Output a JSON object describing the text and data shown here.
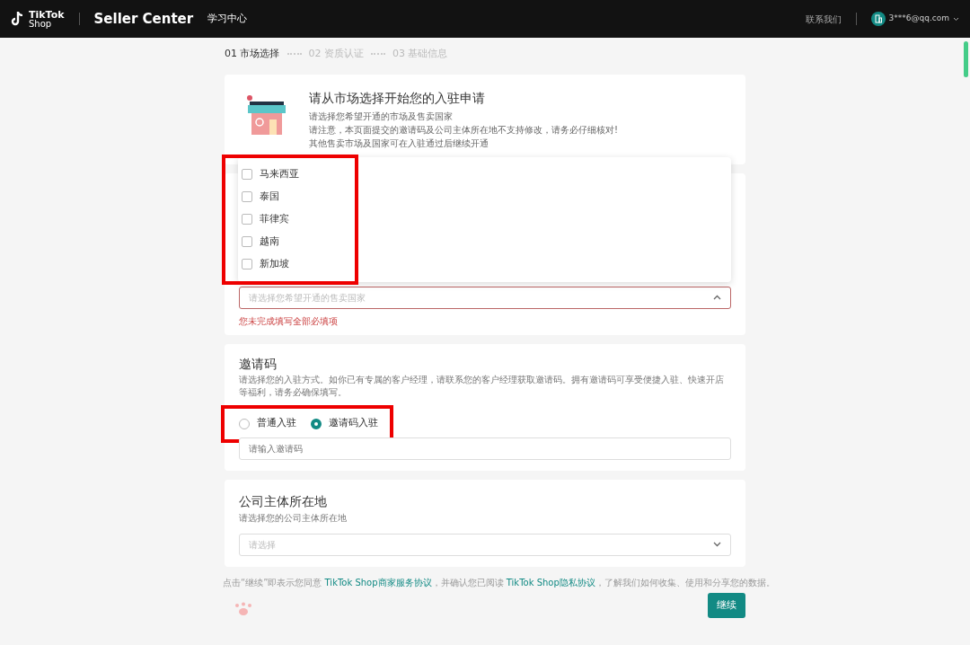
{
  "header": {
    "logo_line1": "TikTok",
    "logo_line2": "Shop",
    "product": "Seller Center",
    "nav_link": "学习中心",
    "contact": "联系我们",
    "account": "3***6@qq.com"
  },
  "steps": [
    {
      "label": "01 市场选择",
      "selected": true
    },
    {
      "label": "02 资质认证",
      "selected": false
    },
    {
      "label": "03 基础信息",
      "selected": false
    }
  ],
  "intro": {
    "title": "请从市场选择开始您的入驻申请",
    "lines": [
      "请选择您希望开通的市场及售卖国家",
      "请注意，本页面提交的邀请码及公司主体所在地不支持修改，请务必仔细核对!",
      "其他售卖市场及国家可在入驻通过后继续开通"
    ]
  },
  "market": {
    "highlighted": true,
    "expanded": true,
    "options": [
      {
        "label": "马来西亚",
        "checked": false
      },
      {
        "label": "泰国",
        "checked": false
      },
      {
        "label": "菲律宾",
        "checked": false
      },
      {
        "label": "越南",
        "checked": false
      },
      {
        "label": "新加坡",
        "checked": false
      }
    ],
    "placeholder": "请选择您希望开通的售卖国家",
    "error": "您未完成填写全部必填项"
  },
  "invite": {
    "title": "邀请码",
    "description": "请选择您的入驻方式。如你已有专属的客户经理，请联系您的客户经理获取邀请码。拥有邀请码可享受便捷入驻、快速开店等福利，请务必确保填写。",
    "highlighted": true,
    "options": [
      {
        "label": "普通入驻",
        "selected": false
      },
      {
        "label": "邀请码入驻",
        "selected": true
      }
    ],
    "placeholder": "请输入邀请码"
  },
  "company": {
    "title": "公司主体所在地",
    "description": "请选择您的公司主体所在地",
    "placeholder": "请选择"
  },
  "agreement": {
    "before": "点击“继续”即表示您同意",
    "link1": "TikTok Shop商家服务协议",
    "middle": "，并确认您已阅读",
    "link2": "TikTok Shop隐私协议",
    "after": "，了解我们如何收集、使用和分享您的数据。"
  },
  "continue_button": "继续"
}
